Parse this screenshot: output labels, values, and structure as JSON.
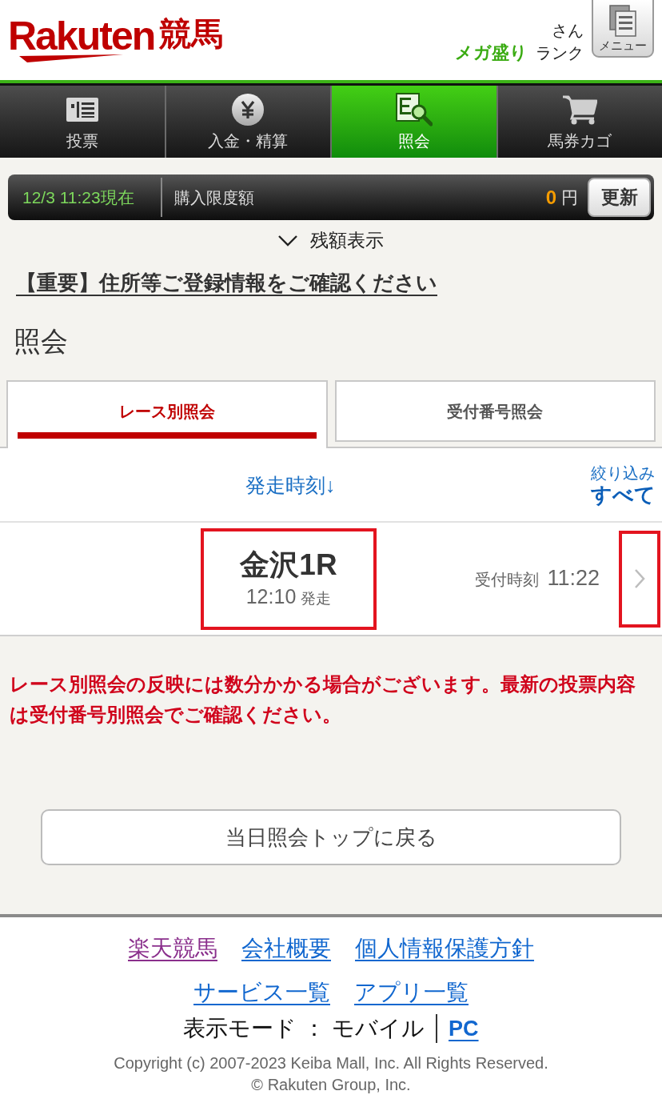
{
  "header": {
    "logo": {
      "brand": "Rakuten",
      "service": "競馬"
    },
    "user": {
      "honorific": "さん",
      "rank": "メガ盛り",
      "rank_label": "ランク"
    },
    "menu_button": "メニュー"
  },
  "nav": [
    {
      "label": "投票",
      "kind": "ballot",
      "selected": false
    },
    {
      "label": "入金・精算",
      "kind": "yen",
      "selected": false
    },
    {
      "label": "照会",
      "kind": "inquiry",
      "selected": true
    },
    {
      "label": "馬券カゴ",
      "kind": "cart",
      "selected": false
    }
  ],
  "account_bar": {
    "timestamp": "12/3 11:23現在",
    "label": "購入限度額",
    "amount": "0",
    "unit": "円",
    "refresh_button": "更新"
  },
  "balance_toggle": {
    "label": "残額表示",
    "expanded": false
  },
  "notice_link": "【重要】住所等ご登録情報をご確認ください",
  "page_title": "照会",
  "tabs": [
    {
      "label": "レース別照会",
      "selected": true
    },
    {
      "label": "受付番号照会",
      "selected": false
    }
  ],
  "sort": {
    "label": "発走時刻↓"
  },
  "filter": {
    "label": "絞り込み",
    "value": "すべて"
  },
  "races": [
    {
      "name": "金沢1R",
      "post_time": "12:10",
      "post_label": "発走",
      "received_label": "受付時刻",
      "received_time": "11:22",
      "highlighted": true
    }
  ],
  "warning": "レース別照会の反映には数分かかる場合がございます。最新の投票内容は受付番号別照会でご確認ください。",
  "back_button": "当日照会トップに戻る",
  "footer": {
    "link_rows": [
      [
        {
          "label": "楽天競馬",
          "visited": true
        },
        {
          "label": "会社概要",
          "visited": false
        },
        {
          "label": "個人情報保護方針",
          "visited": false
        }
      ],
      [
        {
          "label": "サービス一覧",
          "visited": false
        },
        {
          "label": "アプリ一覧",
          "visited": false
        }
      ]
    ],
    "display_mode": {
      "label": "表示モード ： モバイル",
      "pc_link": "PC"
    },
    "copyright": [
      "Copyright (c) 2007-2023 Keiba Mall, Inc. All Rights Reserved.",
      "© Rakuten Group, Inc."
    ]
  }
}
